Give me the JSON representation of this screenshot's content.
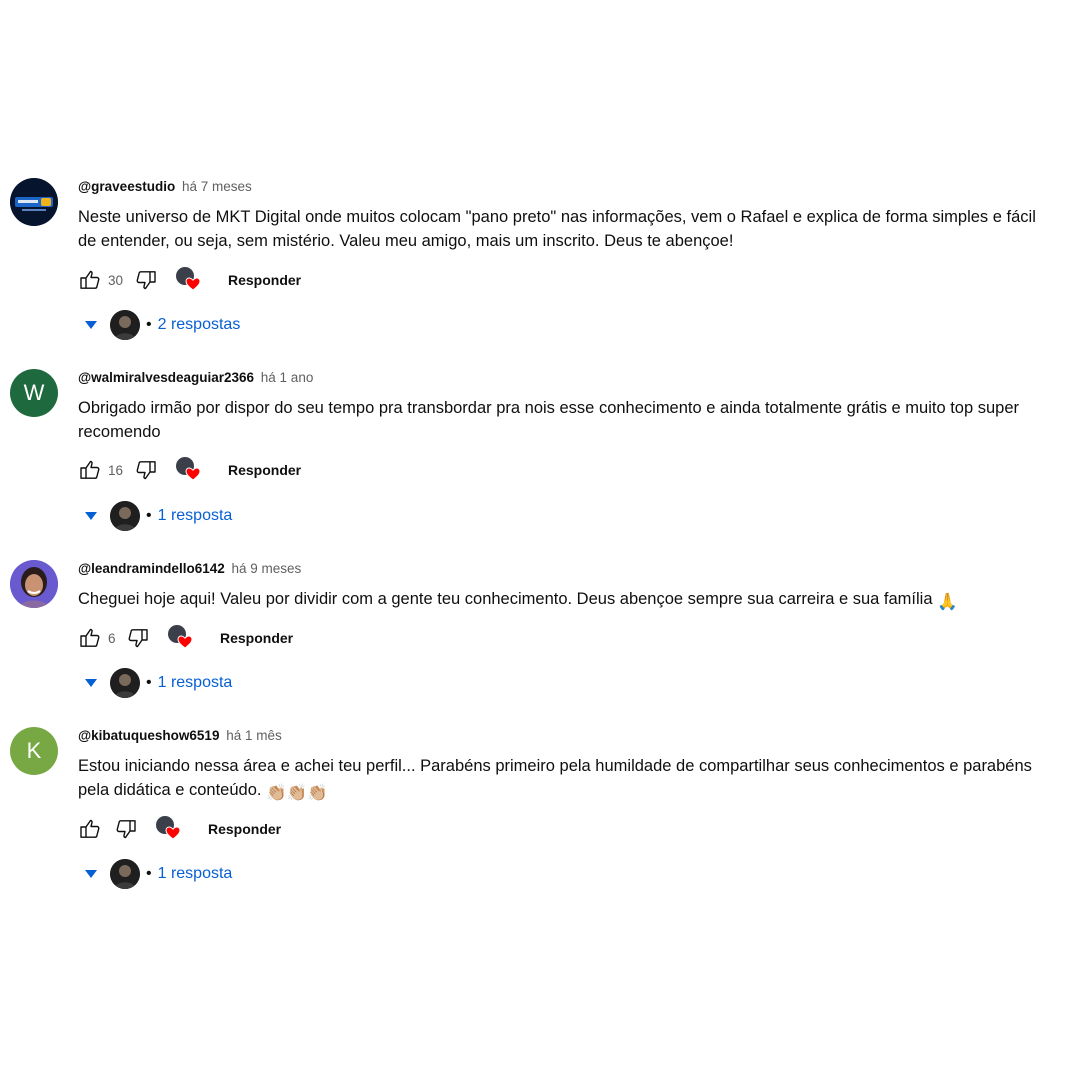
{
  "colors": {
    "link_blue": "#065fd4",
    "meta_gray": "#606060",
    "heart_red": "#ff0000",
    "avatar_w": "#1e6a3e",
    "avatar_k": "#78a844"
  },
  "comments": [
    {
      "author": "@graveestudio",
      "time": "há 7 meses",
      "text": "Neste universo de MKT Digital onde muitos colocam \"pano preto\" nas informações, vem o Rafael e explica de forma simples e fácil de entender, ou seja, sem mistério. Valeu meu amigo, mais um inscrito. Deus te abençoe!",
      "likes": "30",
      "reply_label": "Responder",
      "replies_label": "2 respostas",
      "avatar": {
        "type": "logo",
        "letter": ""
      }
    },
    {
      "author": "@walmiralvesdeaguiar2366",
      "time": "há 1 ano",
      "text": "Obrigado irmão por dispor do seu tempo pra transbordar pra nois esse conhecimento e ainda totalmente grátis e muito top super recomendo",
      "likes": "16",
      "reply_label": "Responder",
      "replies_label": "1 resposta",
      "avatar": {
        "type": "letter",
        "letter": "W"
      }
    },
    {
      "author": "@leandramindello6142",
      "time": "há 9 meses",
      "text": "Cheguei hoje aqui! Valeu por dividir com a gente teu conhecimento. Deus abençoe sempre sua carreira e sua família",
      "text_emoji": "🙏",
      "likes": "6",
      "reply_label": "Responder",
      "replies_label": "1 resposta",
      "avatar": {
        "type": "photo",
        "letter": ""
      }
    },
    {
      "author": "@kibatuqueshow6519",
      "time": "há 1 mês",
      "text": "Estou iniciando nessa área e achei teu perfil... Parabéns primeiro pela humildade de compartilhar seus conhecimentos e parabéns pela didática e conteúdo.",
      "text_emoji": "👏🏼👏🏼👏🏼",
      "likes": "",
      "reply_label": "Responder",
      "replies_label": "1 resposta",
      "avatar": {
        "type": "letter",
        "letter": "K"
      }
    }
  ],
  "icons": {
    "like": "thumbs-up-outline-icon",
    "dislike": "thumbs-down-outline-icon",
    "heart": "creator-heart-icon",
    "caret": "caret-down-icon"
  }
}
